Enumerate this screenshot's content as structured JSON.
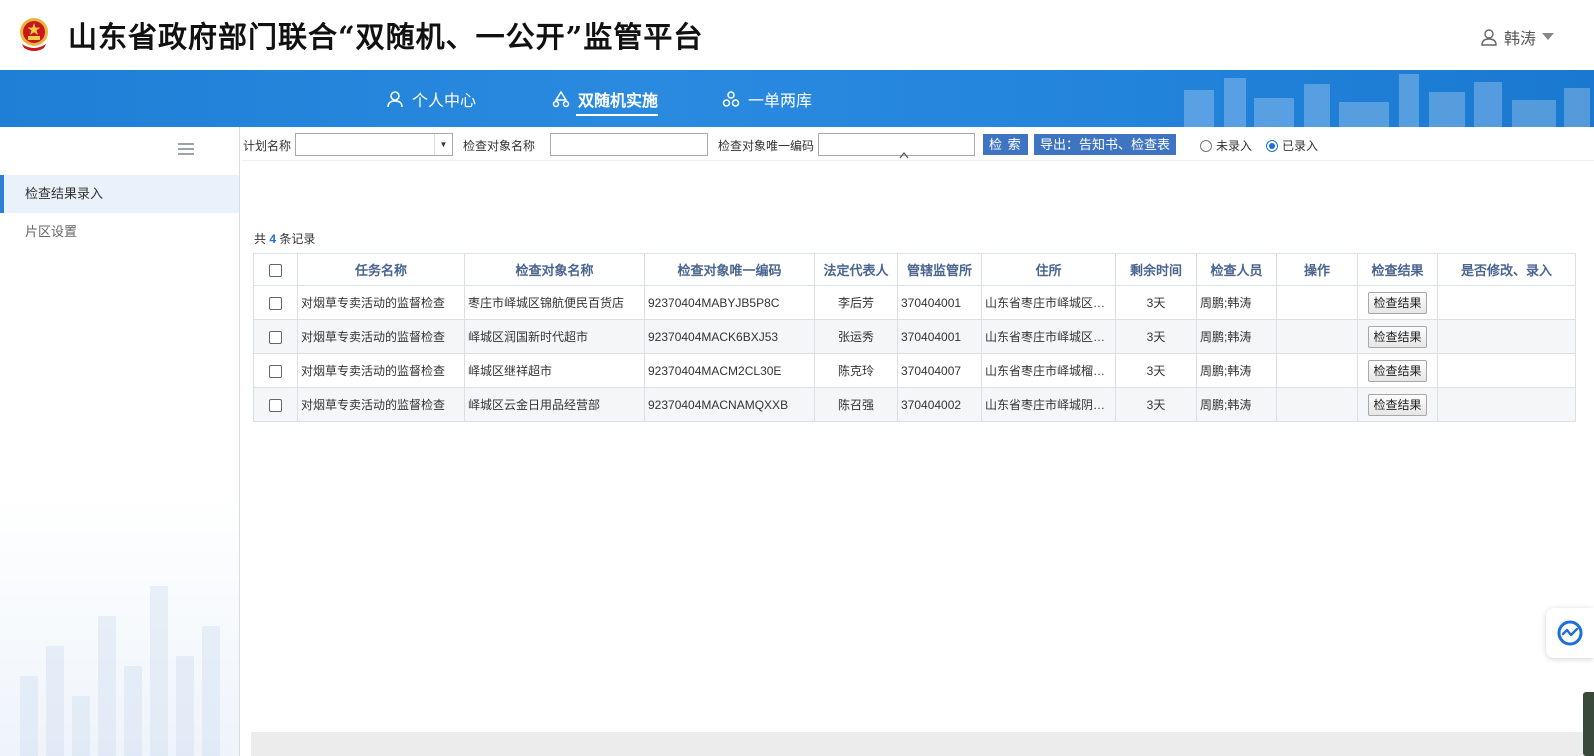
{
  "header": {
    "site_title": "山东省政府部门联合“双随机、一公开”监管平台",
    "user_name": "韩涛"
  },
  "nav": {
    "items": [
      {
        "label": "个人中心",
        "icon": "user-icon"
      },
      {
        "label": "双随机实施",
        "icon": "recycle-icon",
        "active": true
      },
      {
        "label": "一单两库",
        "icon": "cluster-icon"
      }
    ]
  },
  "sidebar": {
    "items": [
      {
        "label": "检查结果录入",
        "active": true
      },
      {
        "label": "片区设置"
      }
    ]
  },
  "filters": {
    "plan_name_label": "计划名称",
    "plan_name_value": "",
    "target_name_label": "检查对象名称",
    "target_name_value": "",
    "target_code_label": "检查对象唯一编码",
    "target_code_value": "",
    "search_label": "检 索",
    "export_label": "导出：告知书、检查表",
    "radio_unentered": "未录入",
    "radio_entered": "已录入",
    "selected_radio": "已录入"
  },
  "records": {
    "prefix": "共",
    "count": "4",
    "suffix": "条记录"
  },
  "table": {
    "columns": [
      "任务名称",
      "检查对象名称",
      "检查对象唯一编码",
      "法定代表人",
      "管辖监管所",
      "住所",
      "剩余时间",
      "检查人员",
      "操作",
      "检查结果",
      "是否修改、录入"
    ],
    "result_button_label": "检查结果",
    "rows": [
      {
        "task": "对烟草专卖活动的监督检查",
        "target": "枣庄市峄城区锦航便民百货店",
        "code": "92370404MABYJB5P8C",
        "legal_rep": "李后芳",
        "station": "370404001",
        "address": "山东省枣庄市峄城区坛...",
        "remaining": "3天",
        "inspectors": "周鹏;韩涛",
        "operation": "",
        "modified": ""
      },
      {
        "task": "对烟草专卖活动的监督检查",
        "target": "峄城区润国新时代超市",
        "code": "92370404MACK6BXJ53",
        "legal_rep": "张运秀",
        "station": "370404001",
        "address": "山东省枣庄市峄城区坛...",
        "remaining": "3天",
        "inspectors": "周鹏;韩涛",
        "operation": "",
        "modified": ""
      },
      {
        "task": "对烟草专卖活动的监督检查",
        "target": "峄城区继祥超市",
        "code": "92370404MACM2CL30E",
        "legal_rep": "陈克玲",
        "station": "370404007",
        "address": "山东省枣庄市峄城榴园...",
        "remaining": "3天",
        "inspectors": "周鹏;韩涛",
        "operation": "",
        "modified": ""
      },
      {
        "task": "对烟草专卖活动的监督检查",
        "target": "峄城区云金日用品经营部",
        "code": "92370404MACNAMQXXB",
        "legal_rep": "陈召强",
        "station": "370404002",
        "address": "山东省枣庄市峄城阴平...",
        "remaining": "3天",
        "inspectors": "周鹏;韩涛",
        "operation": "",
        "modified": ""
      }
    ]
  },
  "colors": {
    "nav_blue": "#2384dc",
    "header_text_blue": "#4a6690",
    "button_blue": "#3f74c2",
    "emblem_red": "#c8161d",
    "emblem_gold": "#e8b53a"
  }
}
